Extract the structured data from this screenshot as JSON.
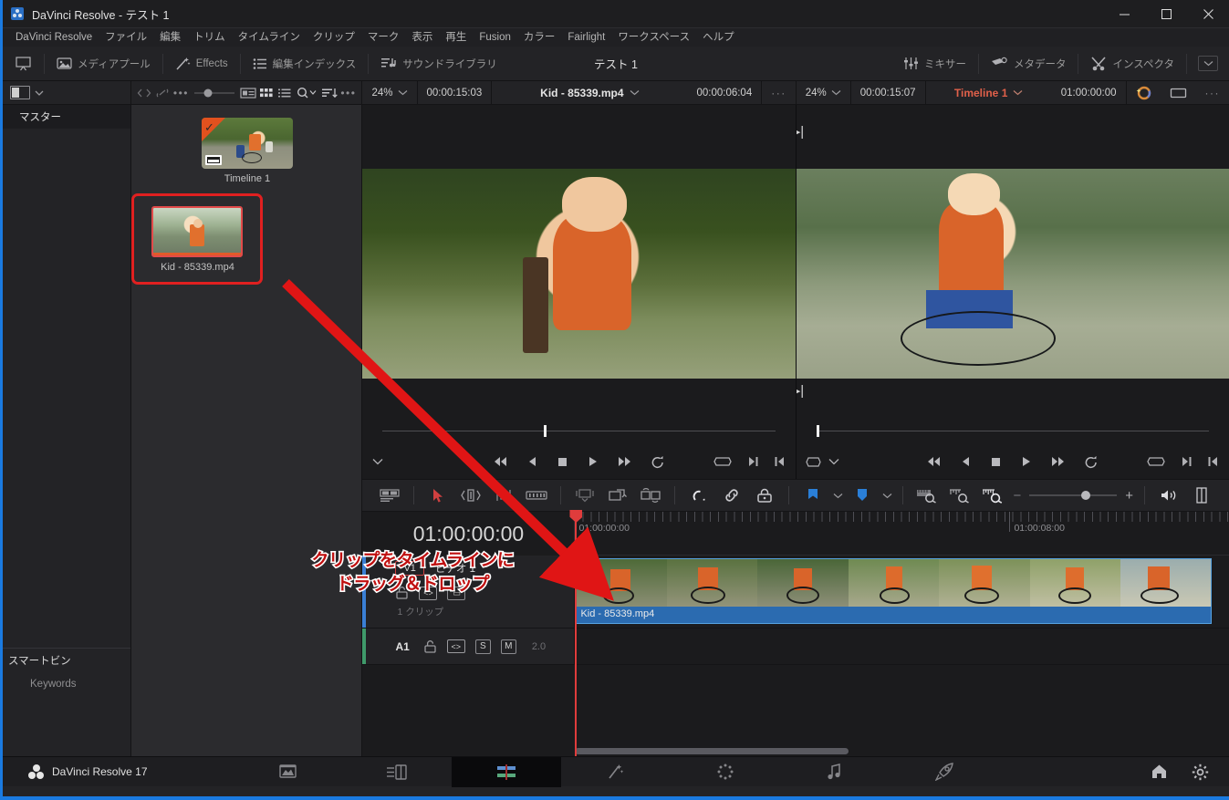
{
  "titlebar": {
    "title": "DaVinci Resolve - テスト 1",
    "app_icon": "davinci-logo-icon",
    "minimize": "minimize-icon",
    "maximize": "maximize-icon",
    "close": "close-icon"
  },
  "menubar": {
    "items": [
      {
        "label": "DaVinci Resolve"
      },
      {
        "label": "ファイル"
      },
      {
        "label": "編集"
      },
      {
        "label": "トリム"
      },
      {
        "label": "タイムライン"
      },
      {
        "label": "クリップ"
      },
      {
        "label": "マーク"
      },
      {
        "label": "表示"
      },
      {
        "label": "再生"
      },
      {
        "label": "Fusion"
      },
      {
        "label": "カラー"
      },
      {
        "label": "Fairlight"
      },
      {
        "label": "ワークスペース"
      },
      {
        "label": "ヘルプ"
      }
    ]
  },
  "toolbar": {
    "left_items": [
      {
        "label": "",
        "icon": "monitor-toggle-icon"
      },
      {
        "label": "メディアプール",
        "icon": "media-pool-icon"
      },
      {
        "label": "Effects",
        "icon": "effects-wand-icon"
      },
      {
        "label": "編集インデックス",
        "icon": "edit-index-icon"
      },
      {
        "label": "サウンドライブラリ",
        "icon": "sound-library-icon"
      }
    ],
    "project_title": "テスト 1",
    "right_items": [
      {
        "label": "ミキサー",
        "icon": "mixer-icon"
      },
      {
        "label": "メタデータ",
        "icon": "metadata-icon"
      },
      {
        "label": "インスペクタ",
        "icon": "inspector-icon"
      }
    ],
    "overflow_label": "chevron-down-icon"
  },
  "bin_sidebar": {
    "toolbar_icons": [
      "panel-toggle-icon",
      "chevron-down-icon"
    ],
    "master_label": "マスター",
    "smart_bins_label": "スマートビン",
    "keywords_label": "Keywords"
  },
  "media_pool": {
    "toolbar_icons": [
      "code-brackets-icon",
      "link-broken-icon",
      "ellipsis-icon",
      "thumb-size-slider-icon",
      "metadata-view-icon",
      "thumbnail-view-icon",
      "list-view-icon",
      "search-icon",
      "sort-icon",
      "more-options-icon"
    ],
    "items": [
      {
        "name": "Timeline 1",
        "type": "timeline",
        "selected": false
      },
      {
        "name": "Kid - 85339.mp4",
        "type": "clip",
        "selected": true
      }
    ]
  },
  "annotation": {
    "line1": "クリップをタイムラインに",
    "line2": "ドラッグ＆ドロップ",
    "color": "#c01010",
    "arrow": "drag-drop-arrow"
  },
  "source_viewer": {
    "zoom": "24%",
    "duration": "00:00:15:03",
    "clip_name": "Kid - 85339.mp4",
    "timecode": "00:00:06:04",
    "overflow": "···"
  },
  "timeline_viewer": {
    "zoom": "24%",
    "duration": "00:00:15:07",
    "timeline_name": "Timeline 1",
    "timecode": "01:00:00:00",
    "color_icon": "color-wheel-icon",
    "frame_icon": "frame-icon",
    "overflow": "···"
  },
  "transport": {
    "buttons": [
      "jump-to-start-icon",
      "step-back-icon",
      "stop-icon",
      "play-icon",
      "jump-to-end-icon",
      "loop-icon"
    ],
    "right_buttons": [
      "in-out-range-icon",
      "mark-out-icon",
      "mark-in-icon"
    ]
  },
  "timeline_toolbar": {
    "items": [
      "timeline-view-options-icon",
      "selection-arrow-icon",
      "trim-edit-icon",
      "dynamic-trim-icon",
      "blade-edit-icon",
      "insert-clip-icon",
      "overwrite-clip-icon",
      "replace-clip-icon",
      "snapping-icon",
      "linked-selection-icon",
      "lock-icon",
      "flag-icon",
      "marker-icon",
      "zoom-fit-icon",
      "zoom-detail-icon",
      "zoom-full-icon",
      "zoom-out-icon",
      "zoom-in-icon",
      "audio-level-icon",
      "split-view-icon"
    ],
    "zoom_minus": "−",
    "zoom_plus": "+"
  },
  "timeline": {
    "current_timecode": "01:00:00:00",
    "ruler_labels": [
      "01:00:00:00",
      "01:00:08:00"
    ],
    "video_track": {
      "badge": "V1",
      "name": "ビデオ 1",
      "clip_count": "1 クリップ",
      "icons": [
        "lock-icon",
        "auto-track-select-icon",
        "thumbnail-toggle-icon"
      ],
      "clip_name": "Kid - 85339.mp4"
    },
    "audio_track": {
      "badge": "A1",
      "icons": [
        "lock-icon",
        "auto-track-select-icon"
      ],
      "solo": "S",
      "mute": "M",
      "channels": "2.0"
    }
  },
  "statusbar": {
    "product": "DaVinci Resolve 17",
    "logo": "resolve-dots-icon",
    "pages": [
      {
        "name": "media-page",
        "icon": "media-page-icon",
        "active": false
      },
      {
        "name": "cut-page",
        "icon": "cut-page-icon",
        "active": false
      },
      {
        "name": "edit-page",
        "icon": "edit-page-icon",
        "active": true
      },
      {
        "name": "fusion-page",
        "icon": "fusion-page-icon",
        "active": false
      },
      {
        "name": "color-page",
        "icon": "color-page-icon",
        "active": false
      },
      {
        "name": "fairlight-page",
        "icon": "fairlight-page-icon",
        "active": false
      },
      {
        "name": "deliver-page",
        "icon": "deliver-page-icon",
        "active": false
      }
    ],
    "home_icon": "home-icon",
    "settings_icon": "gear-icon"
  },
  "colors": {
    "accent_blue": "#1a7ae0",
    "annotation_red": "#c01010",
    "playhead_red": "#e03c3c",
    "clip_blue": "#2b6bb0",
    "timeline_name": "#e0604a"
  }
}
